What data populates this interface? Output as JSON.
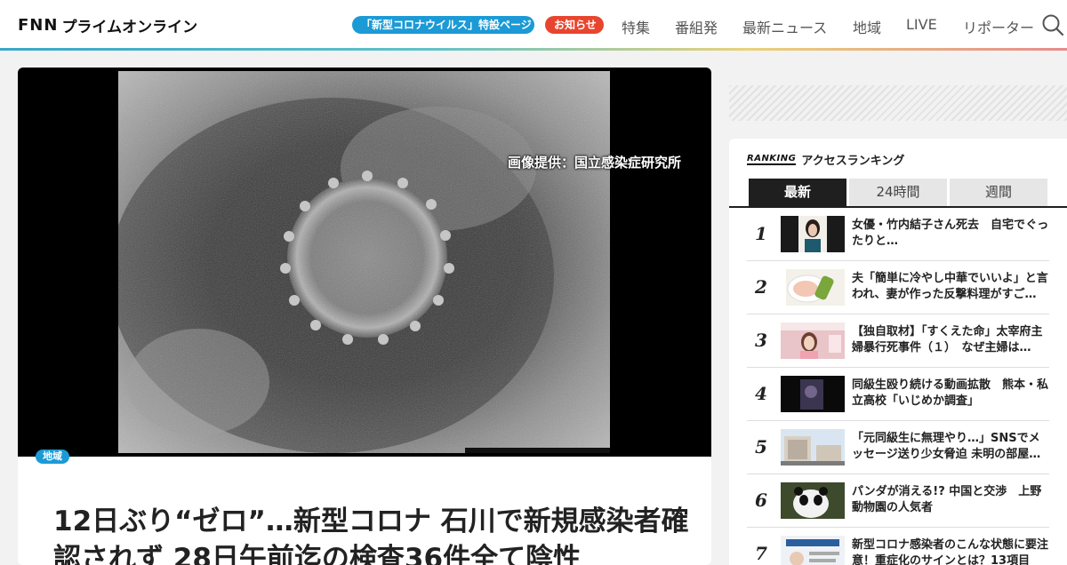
{
  "header": {
    "logo_fnn": "FNN",
    "logo_text": "プライムオンライン",
    "corona_pill": "「新型コロナウイルス」特設ページ",
    "news_pill": "お知らせ",
    "nav": [
      "特集",
      "番組発",
      "最新ニュース",
      "地域",
      "LIVE",
      "リポーター"
    ],
    "search_icon": "search-icon"
  },
  "article": {
    "image_credit": "画像提供：国立感染症研究所",
    "category": "地域",
    "title": "12日ぶり“ゼロ”…新型コロナ 石川で新規感染者確認されず 28日午前迄の検査36件全て陰性"
  },
  "ranking": {
    "badge": "RANKING",
    "title": "アクセスランキング",
    "tabs": [
      "最新",
      "24時間",
      "週間"
    ],
    "active_tab": "最新",
    "items": [
      {
        "rank": "1",
        "text": "女優・竹内結子さん死去　自宅でぐったりと…"
      },
      {
        "rank": "2",
        "text": "夫「簡単に冷やし中華でいいよ」と言われ、妻が作った反撃料理がすご…"
      },
      {
        "rank": "3",
        "text": "【独自取材】「すくえた命」太宰府主婦暴行死事件（１）　なぜ主婦は…"
      },
      {
        "rank": "4",
        "text": "同級生殴り続ける動画拡散　熊本・私立高校「いじめか調査」"
      },
      {
        "rank": "5",
        "text": "「元同級生に無理やり…」SNSでメッセージ送り少女脅迫 未明の部屋…"
      },
      {
        "rank": "6",
        "text": "パンダが消える!? 中国と交渉　上野動物園の人気者"
      },
      {
        "rank": "7",
        "text": "新型コロナ感染者のこんな状態に要注意！重症化のサインとは？13項目"
      }
    ]
  },
  "colors": {
    "accent_blue": "#1b9ad6",
    "accent_red": "#e8452f"
  }
}
